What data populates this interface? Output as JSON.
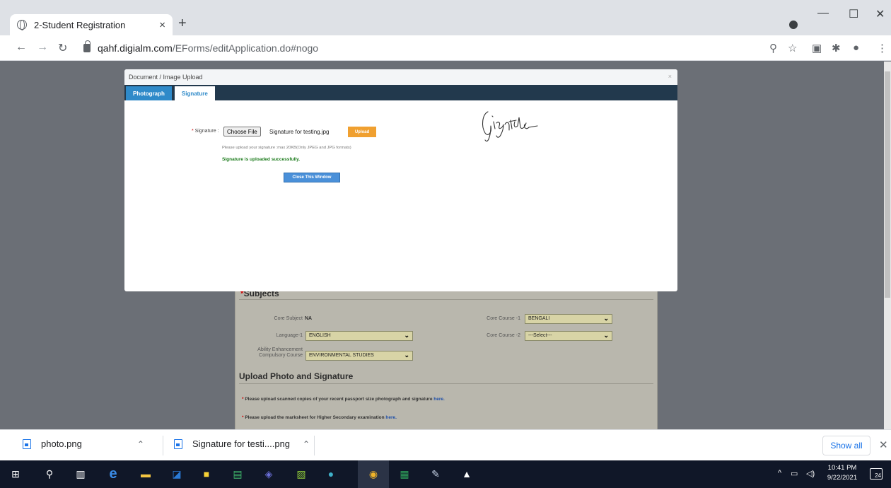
{
  "browser": {
    "tab_title": "2-Student Registration",
    "tab_close": "×",
    "new_tab": "+",
    "url_host": "qahf.digialm.com",
    "url_path": "/EForms/editApplication.do#nogo",
    "window_controls": {
      "minimize": "—",
      "maximize": "☐",
      "close": "✕"
    }
  },
  "form": {
    "subjects_title": "Subjects",
    "core_subject_label": "Core Subject",
    "core_subject_value": "NA",
    "language1_label": "Language-1",
    "language1_value": "ENGLISH",
    "aec_label_1": "Ability Enhancement",
    "aec_label_2": "Compulsory Course",
    "aec_value": "ENVIRONMENTAL STUDIES",
    "core_course1_label": "Core Course -1",
    "core_course1_value": "BENGALI",
    "core_course2_label": "Core Course -2",
    "core_course2_value": "---Select---",
    "upload_title": "Upload Photo and Signature",
    "note1_text": "Please upload scanned copies of your recent passport size photograph and signature",
    "note2_text": "Please upload the marksheet for Higher Secondary examination",
    "here_link": "here."
  },
  "modal": {
    "title": "Document / Image Upload",
    "close": "×",
    "tabs": [
      {
        "label": "Photograph"
      },
      {
        "label": "Signature"
      }
    ],
    "signature_label": "Signature :",
    "choose_file_label": "Choose File",
    "selected_file": "Signature for testing.jpg",
    "upload_label": "Upload",
    "hint": "Please upload your signature :max 20KB(Only JPEG and JPG formats)",
    "success_message": "Signature is uploaded successfully.",
    "close_window_label": "Close This Window"
  },
  "downloads": {
    "items": [
      {
        "name": "photo.png"
      },
      {
        "name": "Signature for testi....png"
      }
    ],
    "show_all": "Show all",
    "close": "✕"
  },
  "taskbar": {
    "time": "10:41 PM",
    "date": "9/22/2021",
    "notification_count": "24",
    "tray_chevron": "^"
  },
  "colors": {
    "modal_tab_active": "#2f8ac9",
    "modal_tabbar": "#22394d",
    "upload_button": "#f0a030",
    "success": "#1a7a1a",
    "close_window_button": "#4a90d9"
  }
}
